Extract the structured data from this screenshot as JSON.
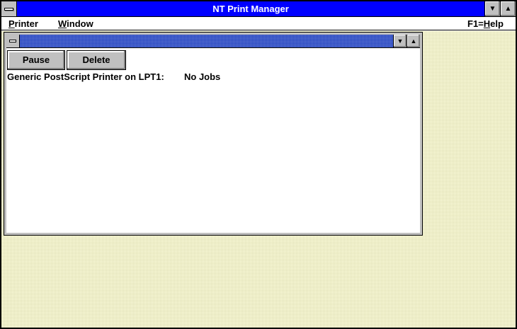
{
  "app": {
    "title": "NT Print Manager"
  },
  "menubar": {
    "items": [
      {
        "label": "Printer"
      },
      {
        "label": "Window"
      }
    ],
    "help": "F1=Help"
  },
  "queue_window": {
    "buttons": {
      "pause": "Pause",
      "delete": "Delete"
    },
    "printers": [
      {
        "name": "Generic PostScript Printer on LPT1:",
        "status": "No Jobs"
      }
    ]
  },
  "colors": {
    "titlebar": "#0000ff",
    "child_titlebar": "#1f3fbf",
    "workspace": "#ffffe0",
    "button_face": "#c0c0c0"
  },
  "icons": {
    "system_menu": "system-menu-icon",
    "minimize": "minimize-arrow-icon",
    "maximize": "maximize-arrow-icon"
  }
}
